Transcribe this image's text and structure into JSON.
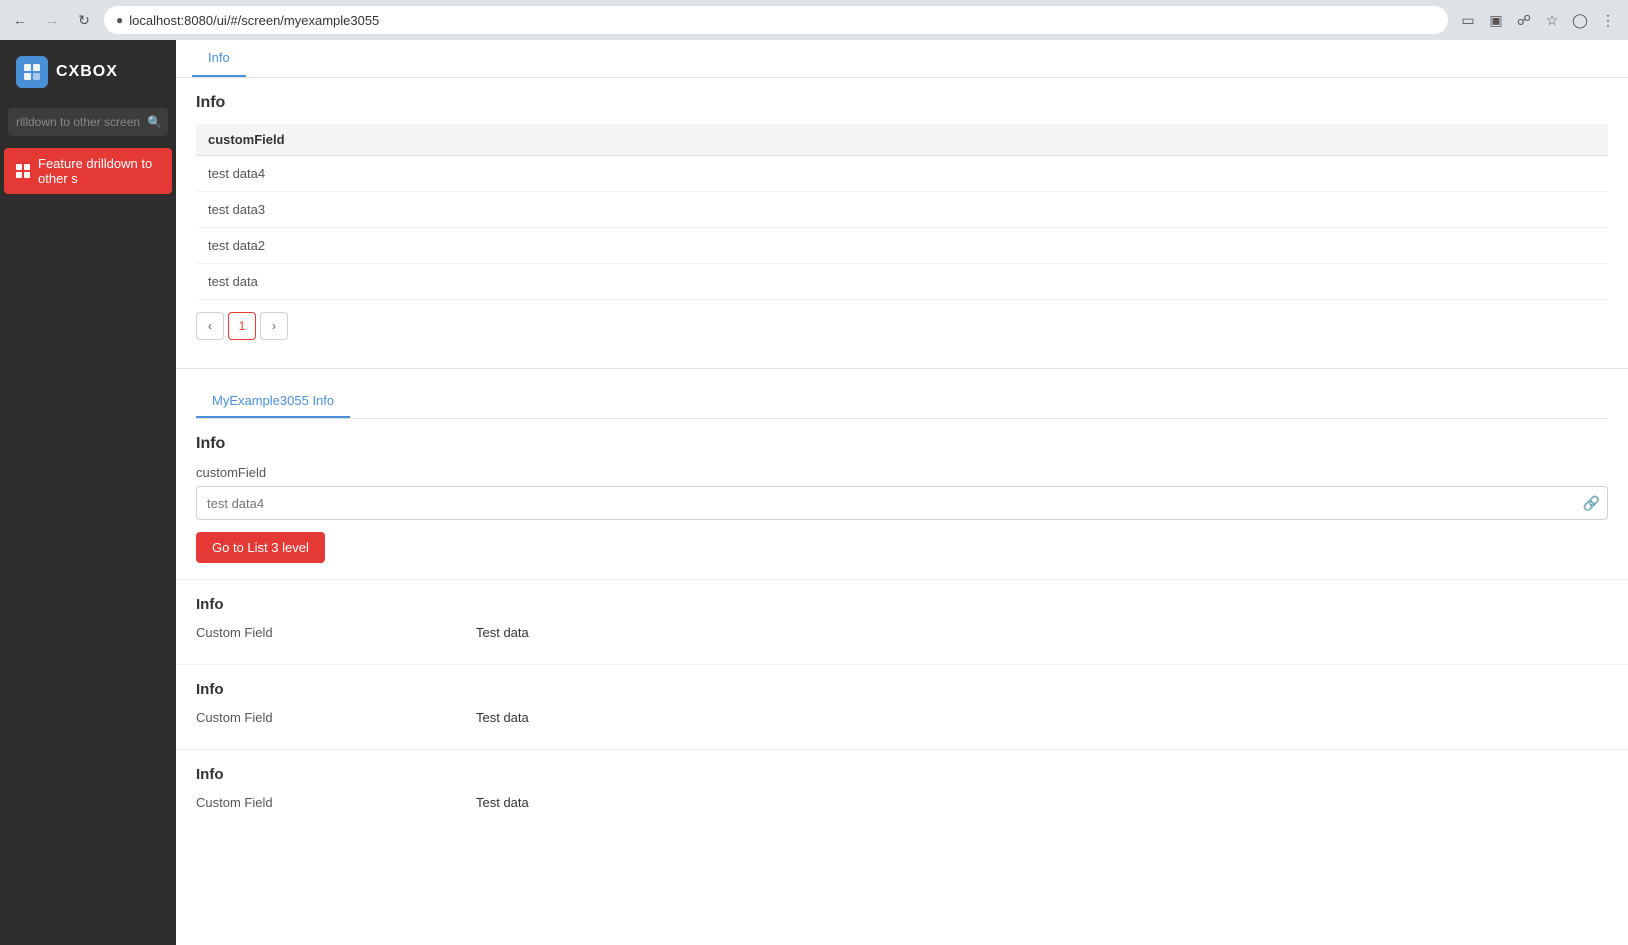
{
  "browser": {
    "url": "localhost:8080/ui/#/screen/myexample3055",
    "back_disabled": false,
    "forward_disabled": true
  },
  "sidebar": {
    "logo_text": "CXBOX",
    "search_placeholder": "rilldown to other screen",
    "menu_items": [
      {
        "id": "feature-drilldown",
        "label": "Feature drilldown to other s",
        "icon": "grid-icon",
        "active": true
      }
    ]
  },
  "top_tab": {
    "label": "Info",
    "active": true
  },
  "list_section": {
    "title": "Info",
    "columns": [
      "customField"
    ],
    "rows": [
      {
        "id": 1,
        "customField": "test data4"
      },
      {
        "id": 2,
        "customField": "test data3"
      },
      {
        "id": 3,
        "customField": "test data2"
      },
      {
        "id": 4,
        "customField": "test data"
      }
    ],
    "pagination": {
      "current_page": 1,
      "prev_label": "‹",
      "next_label": "›"
    }
  },
  "form_section": {
    "inner_tab_label": "MyExample3055 Info",
    "title": "Info",
    "field_label": "customField",
    "field_placeholder": "test data4",
    "link_icon": "🔗",
    "button_label": "Go to List 3 level"
  },
  "info_cards": [
    {
      "title": "Info",
      "rows": [
        {
          "label": "Custom Field",
          "value": "Test data"
        }
      ]
    },
    {
      "title": "Info",
      "rows": [
        {
          "label": "Custom Field",
          "value": "Test data"
        }
      ]
    },
    {
      "title": "Info",
      "rows": [
        {
          "label": "Custom Field",
          "value": "Test data"
        }
      ]
    }
  ]
}
